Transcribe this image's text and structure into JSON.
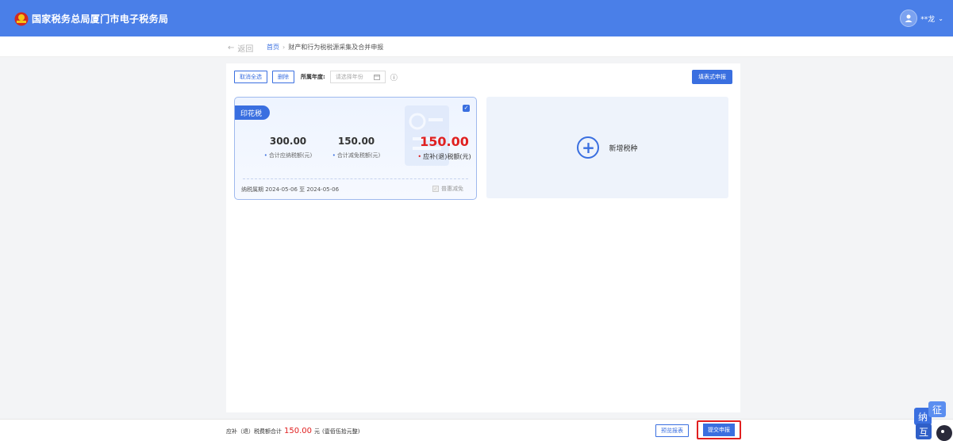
{
  "header": {
    "site_title": "国家税务总局厦门市电子税务局",
    "user_name": "**龙",
    "user_chevron": "⌄"
  },
  "breadcrumb": {
    "back_label": "返回",
    "home": "首页",
    "separator": "›",
    "current": "财产和行为税税源采集及合并申报"
  },
  "toolbar": {
    "cancel_select_all": "取消全选",
    "delete": "删除",
    "year_label": "所属年度:",
    "year_placeholder": "请选择年份",
    "fill_form": "填表式申报"
  },
  "tax_card": {
    "tag": "印花税",
    "payable": "300.00",
    "payable_label": "合计应纳税额(元)",
    "reduction": "150.00",
    "reduction_label": "合计减免税额(元)",
    "due": "150.00",
    "due_label": "应补(退)税额(元)",
    "period": "纳税属期 2024-05-06 至 2024-05-06",
    "discount_label": "普惠减免",
    "checked": true
  },
  "add_card": {
    "label": "新增税种"
  },
  "footer": {
    "sum_prefix": "应补（退）税费额合计",
    "sum_value": "150.00",
    "sum_unit": "元",
    "sum_note": "(壹佰伍拾元整)",
    "select_report": "预览报表",
    "submit": "提交申报"
  },
  "mascot": {
    "text1": "纳",
    "text2": "征",
    "text3": "互"
  },
  "colors": {
    "primary": "#3a6fe0",
    "header": "#4a7fe8",
    "danger": "#e02020"
  }
}
